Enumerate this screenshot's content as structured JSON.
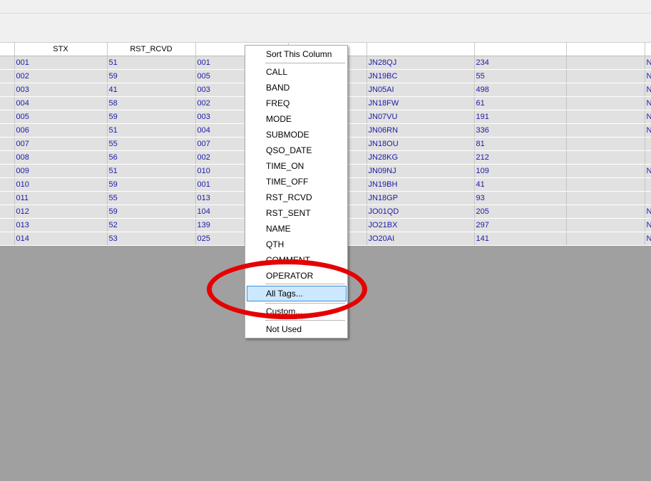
{
  "table": {
    "headers": [
      "",
      "STX",
      "RST_RCVD",
      "",
      "",
      "",
      "",
      "",
      ""
    ],
    "rows": [
      [
        "",
        "001",
        "51",
        "001",
        "",
        "JN28QJ",
        "234",
        "",
        "N"
      ],
      [
        "",
        "002",
        "59",
        "005",
        "",
        "JN19BC",
        "55",
        "",
        "N"
      ],
      [
        "",
        "003",
        "41",
        "003",
        "",
        "JN05AI",
        "498",
        "",
        "N"
      ],
      [
        "",
        "004",
        "58",
        "002",
        "",
        "JN18FW",
        "61",
        "",
        "N"
      ],
      [
        "",
        "005",
        "59",
        "003",
        "",
        "JN07VU",
        "191",
        "",
        "N"
      ],
      [
        "",
        "006",
        "51",
        "004",
        "",
        "JN06RN",
        "336",
        "",
        "N"
      ],
      [
        "",
        "007",
        "55",
        "007",
        "",
        "JN18OU",
        "81",
        "",
        ""
      ],
      [
        "",
        "008",
        "56",
        "002",
        "",
        "JN28KG",
        "212",
        "",
        ""
      ],
      [
        "",
        "009",
        "51",
        "010",
        "",
        "JN09NJ",
        "109",
        "",
        "N"
      ],
      [
        "",
        "010",
        "59",
        "001",
        "",
        "JN19BH",
        "41",
        "",
        ""
      ],
      [
        "",
        "011",
        "55",
        "013",
        "",
        "JN18GP",
        "93",
        "",
        ""
      ],
      [
        "",
        "012",
        "59",
        "104",
        "",
        "JO01QD",
        "205",
        "",
        "N"
      ],
      [
        "",
        "013",
        "52",
        "139",
        "",
        "JO21BX",
        "297",
        "",
        "N"
      ],
      [
        "",
        "014",
        "53",
        "025",
        "",
        "JO20AI",
        "141",
        "",
        "N"
      ]
    ]
  },
  "context_menu": {
    "title": "Sort This Column",
    "items": [
      "CALL",
      "BAND",
      "FREQ",
      "MODE",
      "SUBMODE",
      "QSO_DATE",
      "TIME_ON",
      "TIME_OFF",
      "RST_RCVD",
      "RST_SENT",
      "NAME",
      "QTH",
      "COMMENT",
      "OPERATOR"
    ],
    "all_tags": "All Tags...",
    "custom": "Custom...",
    "not_used": "Not Used"
  },
  "annotation": {
    "color": "#e60000"
  }
}
